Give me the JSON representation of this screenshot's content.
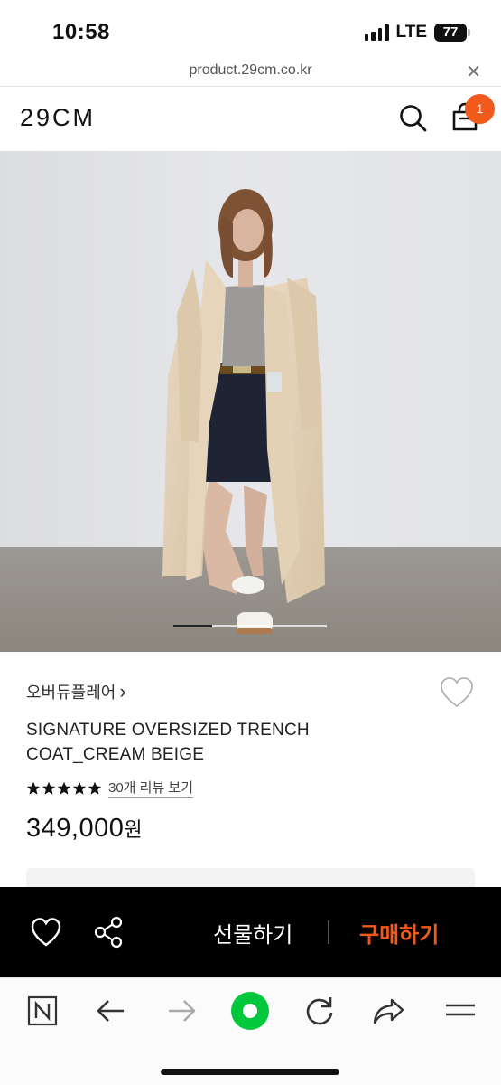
{
  "status": {
    "time": "10:58",
    "network": "LTE",
    "battery": "77"
  },
  "browser": {
    "url": "product.29cm.co.kr",
    "close_symbol": "✕"
  },
  "header": {
    "logo": "29CM",
    "cart_count": "1"
  },
  "product": {
    "brand": "오버듀플레어",
    "brand_chevron": "›",
    "name": "SIGNATURE OVERSIZED TRENCH COAT_CREAM BEIGE",
    "review_link": "30개 리뷰 보기",
    "rating_stars": 5,
    "price": "349,000",
    "price_unit": "원",
    "carousel": {
      "current_fraction": 0.25
    }
  },
  "actions": {
    "gift": "선물하기",
    "buy": "구매하기"
  },
  "colors": {
    "accent": "#f15a1b",
    "bar": "#000000",
    "toolbar_green": "#00c73c"
  },
  "icons": [
    "search-icon",
    "cart-icon",
    "heart-icon",
    "share-icon",
    "naver-n-icon",
    "back-arrow-icon",
    "forward-arrow-icon",
    "green-dot-icon",
    "refresh-icon",
    "share-arrow-icon",
    "menu-icon"
  ]
}
